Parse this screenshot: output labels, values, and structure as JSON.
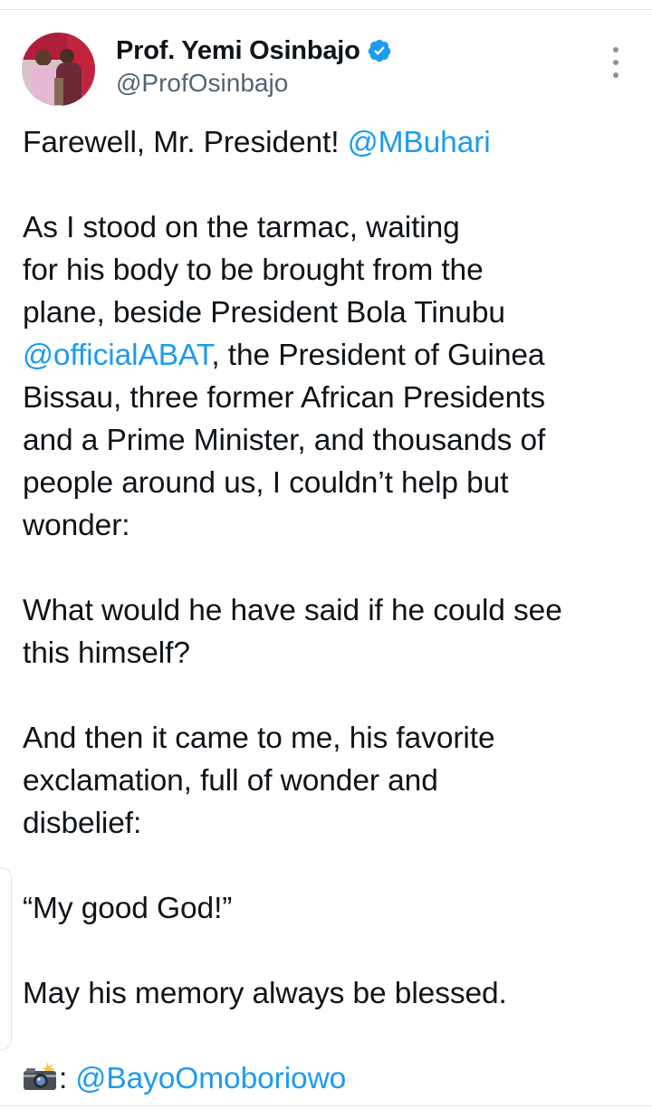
{
  "author": {
    "display_name": "Prof. Yemi Osinbajo",
    "handle": "@ProfOsinbajo",
    "verified_icon": "verified-badge-icon",
    "verified_color": "#1d9bf0"
  },
  "more_menu_icon": "more-vertical-icon",
  "colors": {
    "text": "#0f1419",
    "secondary": "#536471",
    "link": "#1d9bf0"
  },
  "tweet": {
    "p1_text": "Farewell, Mr. President! ",
    "p1_mention": "@MBuhari",
    "p2_l1": "As I stood on the tarmac, waiting",
    "p2_l2": "for his body to be brought from the",
    "p2_l3": "plane, beside President Bola Tinubu",
    "p2_mention": "@officialABAT",
    "p2_l4_rest": ", the President of Guinea",
    "p2_l5": "Bissau, three former African Presidents",
    "p2_l6": "and a Prime Minister, and thousands of",
    "p2_l7": "people around us, I couldn’t help but",
    "p2_l8": "wonder:",
    "p3_l1": "What would he have said if he could see",
    "p3_l2": "this himself?",
    "p4_l1": "And then it came to me, his favorite",
    "p4_l2": "exclamation, full of wonder and",
    "p4_l3": "disbelief:",
    "p5": "“My good God!”",
    "p6": "May his memory always be blessed.",
    "credit_icon": "camera-with-flash-icon",
    "credit_sep": ": ",
    "credit_mention": "@BayoOmoboriowo"
  }
}
